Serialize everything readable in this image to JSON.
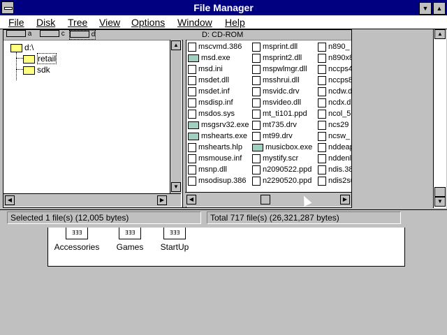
{
  "title": "File Manager",
  "menu": [
    "File",
    "Disk",
    "Tree",
    "View",
    "Options",
    "Window",
    "Help"
  ],
  "drives": [
    "a",
    "c",
    "d"
  ],
  "drive_label": "D: CD-ROM",
  "tree": {
    "root": "d:\\",
    "items": [
      "retail",
      "sdk"
    ],
    "selected": "retail"
  },
  "files": {
    "col1": [
      {
        "name": "mscvmd.386",
        "icon": "doc"
      },
      {
        "name": "msd.exe",
        "icon": "exe"
      },
      {
        "name": "msd.ini",
        "icon": "doc"
      },
      {
        "name": "msdet.dll",
        "icon": "doc"
      },
      {
        "name": "msdet.inf",
        "icon": "doc"
      },
      {
        "name": "msdisp.inf",
        "icon": "doc"
      },
      {
        "name": "msdos.sys",
        "icon": "doc"
      },
      {
        "name": "msgsrv32.exe",
        "icon": "exe"
      },
      {
        "name": "mshearts.exe",
        "icon": "exe"
      },
      {
        "name": "mshearts.hlp",
        "icon": "doc"
      },
      {
        "name": "msmouse.inf",
        "icon": "doc"
      },
      {
        "name": "msnp.dll",
        "icon": "doc"
      },
      {
        "name": "msodisup.386",
        "icon": "doc"
      }
    ],
    "col2": [
      {
        "name": "msprint.dll",
        "icon": "doc"
      },
      {
        "name": "msprint2.dll",
        "icon": "doc"
      },
      {
        "name": "mspwlmgr.dll",
        "icon": "doc"
      },
      {
        "name": "msshrui.dll",
        "icon": "doc"
      },
      {
        "name": "msvidc.drv",
        "icon": "doc"
      },
      {
        "name": "msvideo.dll",
        "icon": "doc"
      },
      {
        "name": "mt_ti101.ppd",
        "icon": "doc"
      },
      {
        "name": "mt735.drv",
        "icon": "doc"
      },
      {
        "name": "mt99.drv",
        "icon": "doc"
      },
      {
        "name": "musicbox.exe",
        "icon": "exe"
      },
      {
        "name": "mystify.scr",
        "icon": "doc"
      },
      {
        "name": "n2090522.ppd",
        "icon": "doc"
      },
      {
        "name": "n2290520.ppd",
        "icon": "doc"
      }
    ],
    "col3": [
      {
        "name": "n890_",
        "icon": "doc"
      },
      {
        "name": "n890x8",
        "icon": "doc"
      },
      {
        "name": "nccps4",
        "icon": "doc"
      },
      {
        "name": "nccps8",
        "icon": "doc"
      },
      {
        "name": "ncdw.d",
        "icon": "doc"
      },
      {
        "name": "ncdx.d",
        "icon": "doc"
      },
      {
        "name": "ncol_5",
        "icon": "doc"
      },
      {
        "name": "ncs29",
        "icon": "doc"
      },
      {
        "name": "ncsw_",
        "icon": "doc"
      },
      {
        "name": "nddeap",
        "icon": "doc"
      },
      {
        "name": "nddenl",
        "icon": "doc"
      },
      {
        "name": "ndis.38",
        "icon": "doc"
      },
      {
        "name": "ndis2su",
        "icon": "doc"
      }
    ]
  },
  "status": {
    "selected": "Selected 1 file(s) (12,005 bytes)",
    "total": "Total 717 file(s) (26,321,287 bytes)"
  },
  "program_groups": [
    "Accessories",
    "Games",
    "StartUp"
  ]
}
